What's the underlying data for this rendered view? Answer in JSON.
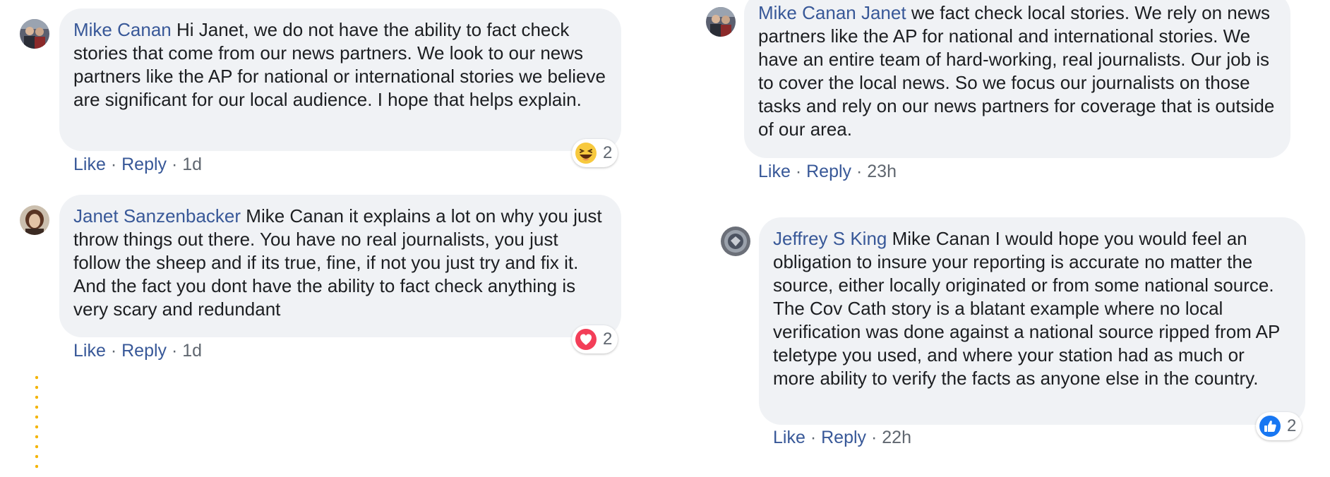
{
  "comments": {
    "c1": {
      "author": "Mike Canan",
      "text": "Hi Janet, we do not have the ability to fact check stories that come from our news partners. We look to our news partners like the AP for national or international stories we believe are significant for our local audience. I hope that helps explain.",
      "like": "Like",
      "reply": "Reply",
      "time": "1d",
      "reaction": {
        "icon": "haha-emoji-icon",
        "count": "2"
      }
    },
    "c2": {
      "author": "Janet Sanzenbacker",
      "text": "Mike Canan it explains a lot on why you just throw things out there. You have no real journalists, you just follow the sheep and if its true, fine, if not you just try and fix it. And the fact you dont have the ability to fact check anything is very scary and redundant",
      "like": "Like",
      "reply": "Reply",
      "time": "1d",
      "reaction": {
        "icon": "love-heart-icon",
        "count": "2"
      }
    },
    "c3": {
      "author": "Mike Canan",
      "mention": "Janet",
      "text": "we fact check local stories. We rely on news partners like the AP for national and international stories. We have an entire team of hard-working, real journalists. Our job is to cover the local news. So we focus our journalists on those tasks and rely on our news partners for coverage that is outside of our area.",
      "like": "Like",
      "reply": "Reply",
      "time": "23h"
    },
    "c4": {
      "author": "Jeffrey S King",
      "text": "Mike Canan I would hope you would feel an obligation to insure your reporting is accurate no matter the source, either locally originated or from some national source. The Cov Cath story is a blatant example where no local verification was done against a national source ripped from AP teletype you used, and where your station had as much or more ability to verify the facts as anyone else in the country.",
      "like": "Like",
      "reply": "Reply",
      "time": "22h",
      "reaction": {
        "icon": "thumbs-up-icon",
        "count": "2"
      }
    }
  },
  "separator": "·",
  "colors": {
    "link": "#385898",
    "bubble": "#f0f2f5",
    "meta": "#606770",
    "thread": "#f5b400"
  }
}
